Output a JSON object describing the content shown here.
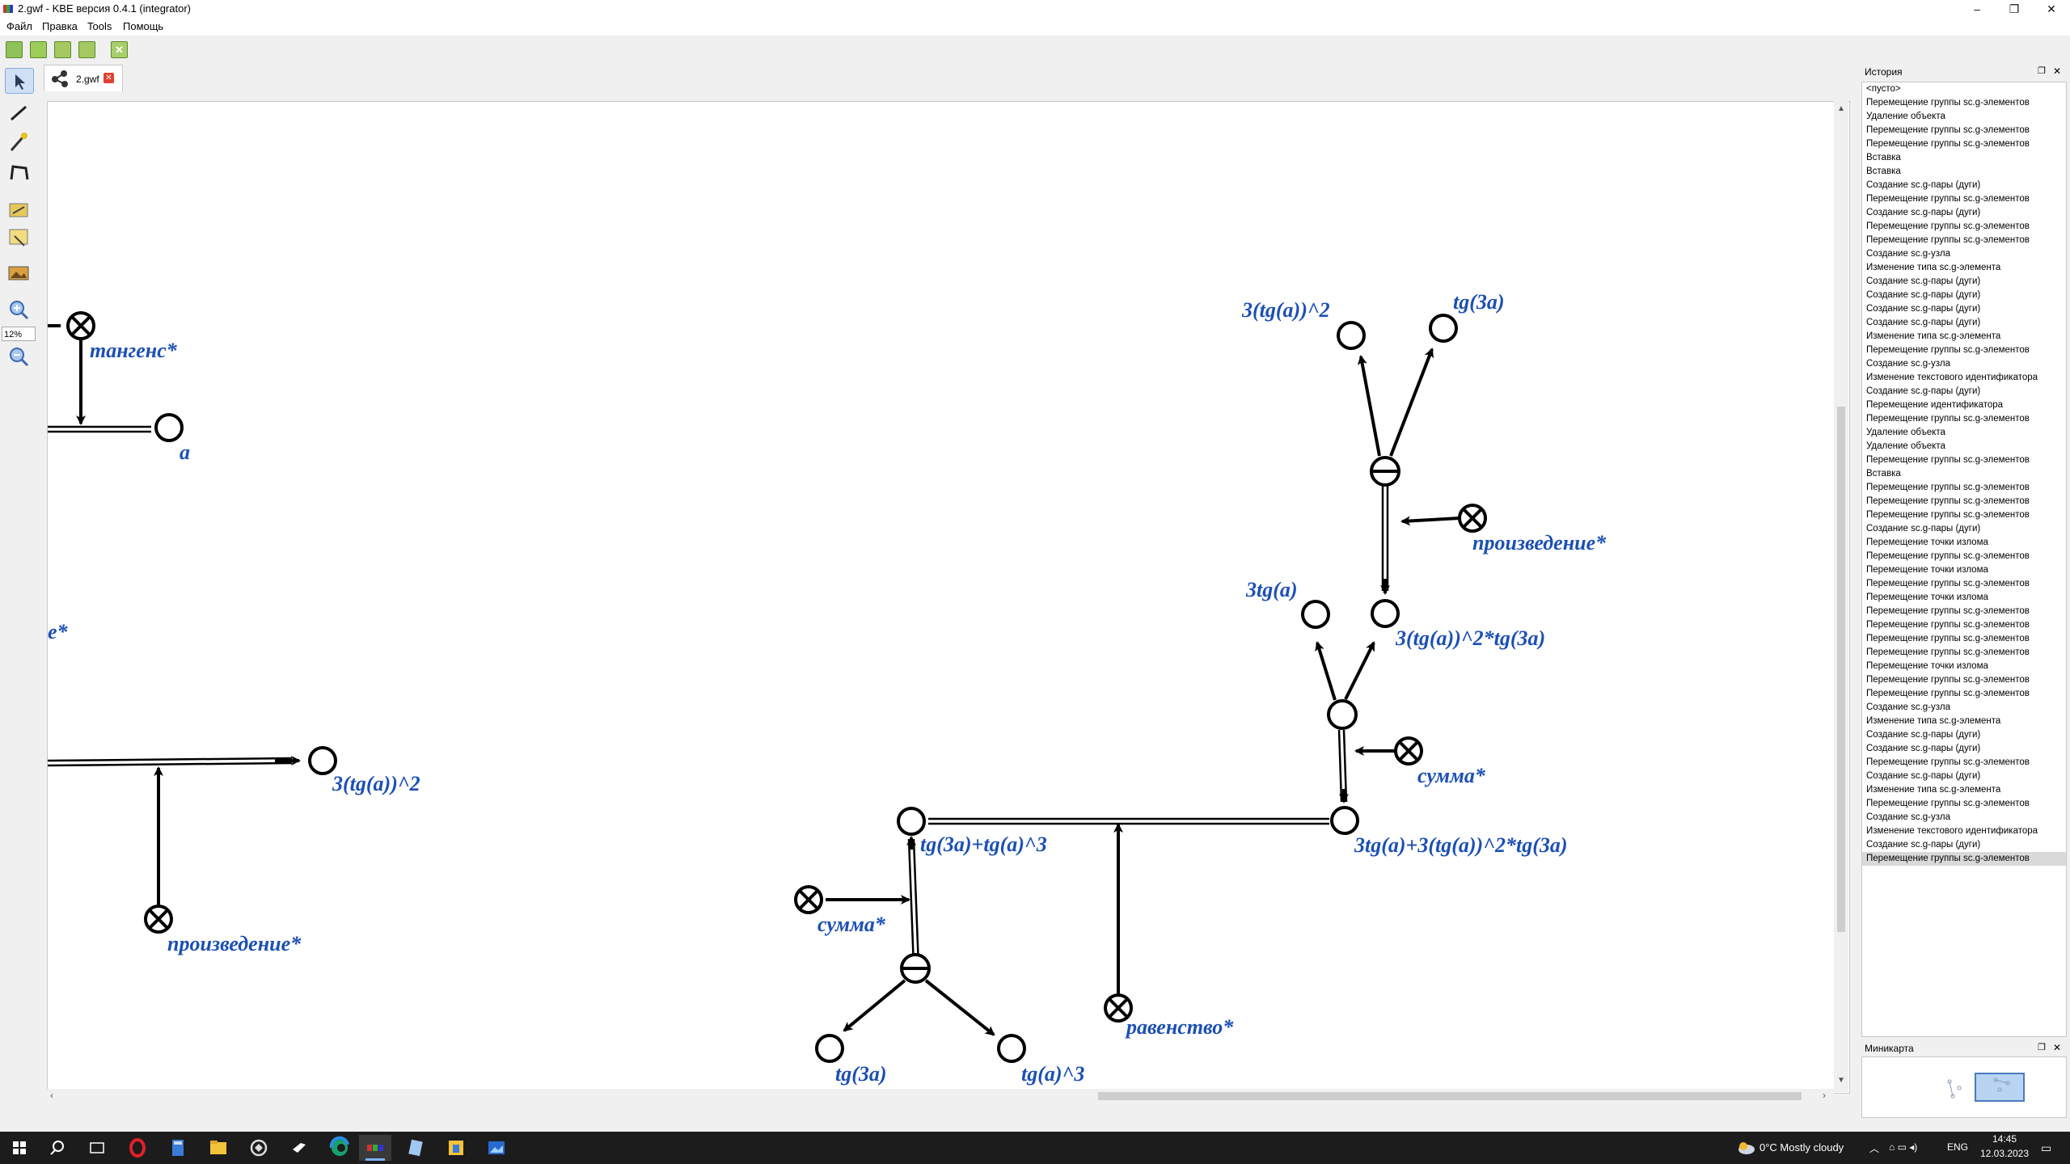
{
  "window": {
    "title": "2.gwf - KBE версия 0.4.1  (integrator)",
    "controls": [
      "–",
      "❐",
      "✕"
    ]
  },
  "menu": [
    "Файл",
    "Правка",
    "Tools",
    "Помощь"
  ],
  "toolbar": {
    "icons": [
      "new-file-icon",
      "open-folder-icon",
      "save-icon",
      "save-all-icon",
      "close-icon"
    ]
  },
  "left_tools": {
    "icons": [
      "select-pointer-icon",
      "pencil-arc-icon",
      "brush-icon",
      "contour-icon",
      "image-edit-icon",
      "find-icon",
      "picture-icon",
      "zoom-in-icon",
      "zoom-out-icon"
    ],
    "zoom_value": "12%"
  },
  "tab": {
    "label": "2.gwf",
    "close": "✕"
  },
  "graph": {
    "labels": {
      "tangens": "тангенс*",
      "a": "a",
      "e_star": "e*",
      "cube_sq_left": "3(tg(a))^2",
      "product_left": "произведение*",
      "cube_sq_top": "3(tg(a))^2",
      "tg3a_top": "tg(3a)",
      "product_right": "произведение*",
      "three_tg": "3tg(a)",
      "cube_prod": "3(tg(a))^2*tg(3a)",
      "sum_right": "сумма*",
      "left_expr": "tg(3a)+tg(a)^3",
      "right_expr": "3tg(a)+3(tg(a))^2*tg(3a)",
      "sum_left": "сумма*",
      "equality": "равенство*",
      "tg3a_bottom": "tg(3a)",
      "tga3_bottom": "tg(a)^3"
    }
  },
  "history_panel": {
    "title": "История",
    "items": [
      "<пусто>",
      "Перемещение группы sc.g-элементов",
      "Удаление объекта",
      "Перемещение группы sc.g-элементов",
      "Перемещение группы sc.g-элементов",
      "Вставка",
      "Вставка",
      "Создание sc.g-пары (дуги)",
      "Перемещение группы sc.g-элементов",
      "Создание sc.g-пары (дуги)",
      "Перемещение группы sc.g-элементов",
      "Перемещение группы sc.g-элементов",
      "Создание sc.g-узла",
      "Изменение типа sc.g-элемента",
      "Создание sc.g-пары (дуги)",
      "Создание sc.g-пары (дуги)",
      "Создание sc.g-пары (дуги)",
      "Создание sc.g-пары (дуги)",
      "Изменение типа sc.g-элемента",
      "Перемещение группы sc.g-элементов",
      "Создание sc.g-узла",
      "Изменение текстового идентификатора",
      "Создание sc.g-пары (дуги)",
      "Перемещение идентификатора",
      "Перемещение группы sc.g-элементов",
      "Удаление объекта",
      "Удаление объекта",
      "Перемещение группы sc.g-элементов",
      "Вставка",
      "Перемещение группы sc.g-элементов",
      "Перемещение группы sc.g-элементов",
      "Перемещение группы sc.g-элементов",
      "Создание sc.g-пары (дуги)",
      "Перемещение точки излома",
      "Перемещение группы sc.g-элементов",
      "Перемещение точки излома",
      "Перемещение группы sc.g-элементов",
      "Перемещение точки излома",
      "Перемещение группы sc.g-элементов",
      "Перемещение группы sc.g-элементов",
      "Перемещение группы sc.g-элементов",
      "Перемещение группы sc.g-элементов",
      "Перемещение точки излома",
      "Перемещение группы sc.g-элементов",
      "Перемещение группы sc.g-элементов",
      "Создание sc.g-узла",
      "Изменение типа sc.g-элемента",
      "Создание sc.g-пары (дуги)",
      "Создание sc.g-пары (дуги)",
      "Перемещение группы sc.g-элементов",
      "Создание sc.g-пары (дуги)",
      "Изменение типа sc.g-элемента",
      "Перемещение группы sc.g-элементов",
      "Создание sc.g-узла",
      "Изменение текстового идентификатора",
      "Создание sc.g-пары (дуги)",
      "Перемещение группы sc.g-элементов"
    ],
    "selected_index": 56
  },
  "minimap_panel": {
    "title": "Миникарта"
  },
  "taskbar": {
    "weather": "0°C  Mostly cloudy",
    "lang": "ENG",
    "time": "14:45",
    "date": "12.03.2023"
  }
}
